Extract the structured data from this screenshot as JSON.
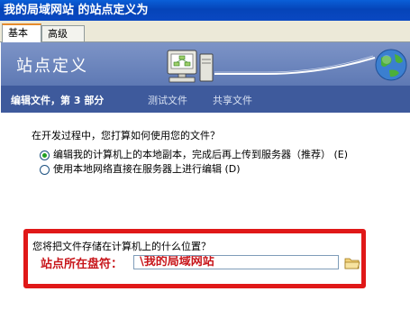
{
  "window": {
    "title": "我的局域网站 的站点定义为"
  },
  "tabs": [
    {
      "label": "基本",
      "active": true
    },
    {
      "label": "高级",
      "active": false
    }
  ],
  "banner": {
    "title": "站点定义"
  },
  "steps": {
    "current": "编辑文件，第 3 部分",
    "others": [
      "测试文件",
      "共享文件"
    ]
  },
  "question": "在开发过程中，您打算如何使用您的文件？",
  "options": [
    {
      "label": "编辑我的计算机上的本地副本，完成后再上传到服务器（推荐）",
      "shortcut": "(E)",
      "checked": true
    },
    {
      "label": "使用本地网络直接在服务器上进行编辑",
      "shortcut": "(D)",
      "checked": false
    }
  ],
  "location": {
    "question": "您将把文件存储在计算机上的什么位置？",
    "annotation": "站点所在盘符：",
    "path_value": "\\我的局域网站"
  },
  "colors": {
    "accent_red": "#e01818",
    "annotation_red": "#c8161b",
    "step_bar": "#3e5a9c",
    "banner": "#6b84bd"
  },
  "icons": [
    "network-computer-icon",
    "globe-icon",
    "folder-icon"
  ]
}
